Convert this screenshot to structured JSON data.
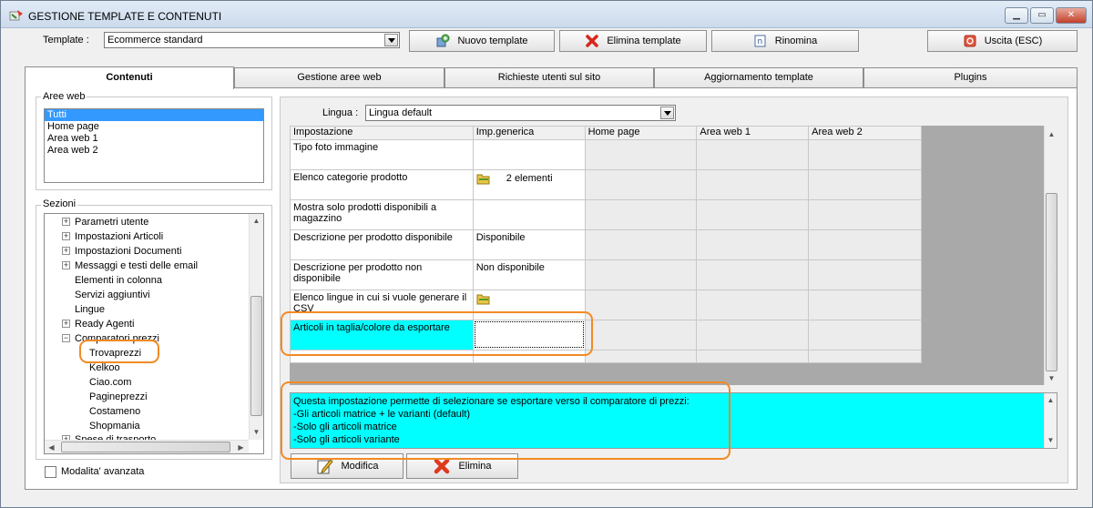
{
  "window": {
    "title": "GESTIONE TEMPLATE E CONTENUTI"
  },
  "toolbar": {
    "template_label": "Template :",
    "template_value": "Ecommerce standard",
    "new_template": "Nuovo template",
    "delete_template": "Elimina template",
    "rename": "Rinomina",
    "exit": "Uscita (ESC)"
  },
  "tabs": [
    "Contenuti",
    "Gestione aree web",
    "Richieste utenti sul sito",
    "Aggiornamento template",
    "Plugins"
  ],
  "aree_web": {
    "title": "Aree web",
    "items": [
      "Tutti",
      "Home page",
      "Area web 1",
      "Area web 2"
    ],
    "selected": "Tutti"
  },
  "sezioni": {
    "title": "Sezioni",
    "items": [
      "Parametri utente",
      "Impostazioni Articoli",
      "Impostazioni Documenti",
      "Messaggi e testi delle email",
      "Elementi in colonna",
      "Servizi aggiuntivi",
      "Lingue",
      "Ready Agenti",
      "Comparatori prezzi",
      "Trovaprezzi",
      "Kelkoo",
      "Ciao.com",
      "Pagineprezzi",
      "Costameno",
      "Shopmania",
      "Spese di trasporto"
    ]
  },
  "modalita_avanzata": "Modalita' avanzata",
  "lingua": {
    "label": "Lingua :",
    "value": "Lingua default"
  },
  "grid": {
    "columns": [
      "Impostazione",
      "Imp.generica",
      "Home page",
      "Area web 1",
      "Area web 2"
    ],
    "rows": [
      [
        "Tipo foto immagine",
        "",
        "",
        "",
        ""
      ],
      [
        "Elenco categorie prodotto",
        "2 elementi",
        "",
        "",
        ""
      ],
      [
        "Mostra solo prodotti disponibili a magazzino",
        "",
        "",
        "",
        ""
      ],
      [
        "Descrizione per prodotto disponibile",
        "Disponibile",
        "",
        "",
        ""
      ],
      [
        "Descrizione per prodotto non disponibile",
        "Non disponibile",
        "",
        "",
        ""
      ],
      [
        "Elenco lingue in cui si vuole generare il CSV",
        "",
        "",
        "",
        ""
      ],
      [
        "Articoli in taglia/colore da esportare",
        "",
        "",
        "",
        ""
      ]
    ]
  },
  "description": [
    "Questa impostazione permette di selezionare se esportare verso il comparatore di prezzi:",
    "-Gli articoli matrice + le varianti (default)",
    "-Solo gli articoli matrice",
    "-Solo gli articoli variante"
  ],
  "actions": {
    "edit": "Modifica",
    "delete": "Elimina"
  },
  "colors": {
    "selection_cyan": "#00ffff",
    "highlight_orange": "#f28a24",
    "list_selected": "#3399ff"
  }
}
